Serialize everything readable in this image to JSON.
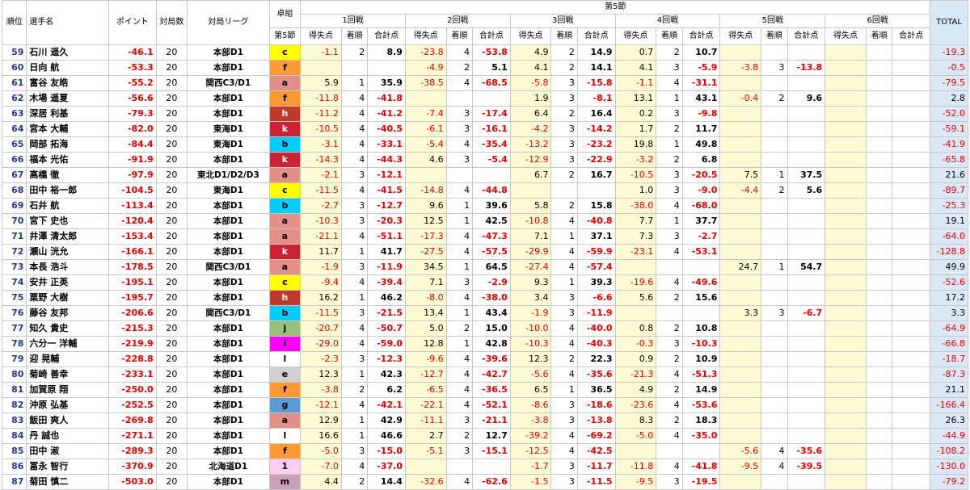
{
  "header": {
    "rank": "順位",
    "player": "選手名",
    "points": "ポイント",
    "games": "対局数",
    "league": "対局リーグ",
    "table_group": "卓組",
    "section": "第5節",
    "section_sub": "第5節",
    "rounds": [
      "1回戦",
      "2回戦",
      "3回戦",
      "4回戦",
      "5回戦",
      "6回戦"
    ],
    "score": "得失点",
    "place": "着順",
    "cumulative": "合計点",
    "total": "TOTAL"
  },
  "colors": {
    "c": "#ffff00",
    "f": "#ff9933",
    "a": "#e39089",
    "h": "#c0392b",
    "b": "#00ccff",
    "k": "#cc2233",
    "j": "#99c07a",
    "i": "#ff00ff",
    "l": "#ffffff",
    "e": "#d0d0d0",
    "g": "#5b9bd5",
    "1": "#ffccf2",
    "m": "#c8a0b8"
  },
  "rows": [
    {
      "rank": "59",
      "name": "石川 遥久",
      "points": "-46.1",
      "games": "20",
      "league": "本部D1",
      "table": "c",
      "r": [
        [
          "-1.1",
          "2",
          "8.9"
        ],
        [
          "-23.8",
          "4",
          "-53.8"
        ],
        [
          "4.9",
          "2",
          "14.9"
        ],
        [
          "0.7",
          "2",
          "10.7"
        ],
        [
          "",
          "",
          ""
        ],
        [
          "",
          "",
          ""
        ]
      ],
      "total": "-19.3"
    },
    {
      "rank": "60",
      "name": "日向 航",
      "points": "-53.3",
      "games": "20",
      "league": "本部D1",
      "table": "f",
      "r": [
        [
          "",
          "",
          ""
        ],
        [
          "-4.9",
          "2",
          "5.1"
        ],
        [
          "4.1",
          "2",
          "14.1"
        ],
        [
          "4.1",
          "3",
          "-5.9"
        ],
        [
          "-3.8",
          "3",
          "-13.8"
        ],
        [
          "",
          "",
          ""
        ]
      ],
      "total": "-0.5"
    },
    {
      "rank": "61",
      "name": "富谷 友皓",
      "points": "-55.2",
      "games": "20",
      "league": "関西C3/D1",
      "table": "a",
      "r": [
        [
          "5.9",
          "1",
          "35.9"
        ],
        [
          "-38.5",
          "4",
          "-68.5"
        ],
        [
          "-5.8",
          "3",
          "-15.8"
        ],
        [
          "-1.1",
          "4",
          "-31.1"
        ],
        [
          "",
          "",
          ""
        ],
        [
          "",
          "",
          ""
        ]
      ],
      "total": "-79.5"
    },
    {
      "rank": "62",
      "name": "木場 遥夏",
      "points": "-56.6",
      "games": "20",
      "league": "本部D1",
      "table": "f",
      "r": [
        [
          "-11.8",
          "4",
          "-41.8"
        ],
        [
          "",
          "",
          ""
        ],
        [
          "1.9",
          "3",
          "-8.1"
        ],
        [
          "13.1",
          "1",
          "43.1"
        ],
        [
          "-0.4",
          "2",
          "9.6"
        ],
        [
          "",
          "",
          ""
        ]
      ],
      "total": "2.8"
    },
    {
      "rank": "63",
      "name": "深居 利基",
      "points": "-79.3",
      "games": "20",
      "league": "本部D1",
      "table": "h",
      "r": [
        [
          "-11.2",
          "4",
          "-41.2"
        ],
        [
          "-7.4",
          "3",
          "-17.4"
        ],
        [
          "6.4",
          "2",
          "16.4"
        ],
        [
          "0.2",
          "3",
          "-9.8"
        ],
        [
          "",
          "",
          ""
        ],
        [
          "",
          "",
          ""
        ]
      ],
      "total": "-52.0"
    },
    {
      "rank": "64",
      "name": "宮本 大輔",
      "points": "-82.0",
      "games": "20",
      "league": "東海D1",
      "table": "k",
      "r": [
        [
          "-10.5",
          "4",
          "-40.5"
        ],
        [
          "-6.1",
          "3",
          "-16.1"
        ],
        [
          "-4.2",
          "3",
          "-14.2"
        ],
        [
          "1.7",
          "2",
          "11.7"
        ],
        [
          "",
          "",
          ""
        ],
        [
          "",
          "",
          ""
        ]
      ],
      "total": "-59.1"
    },
    {
      "rank": "65",
      "name": "岡部 拓海",
      "points": "-84.4",
      "games": "20",
      "league": "東海D1",
      "table": "b",
      "r": [
        [
          "-3.1",
          "4",
          "-33.1"
        ],
        [
          "-5.4",
          "4",
          "-35.4"
        ],
        [
          "-13.2",
          "3",
          "-23.2"
        ],
        [
          "19.8",
          "1",
          "49.8"
        ],
        [
          "",
          "",
          ""
        ],
        [
          "",
          "",
          ""
        ]
      ],
      "total": "-41.9"
    },
    {
      "rank": "66",
      "name": "福本 光佑",
      "points": "-91.9",
      "games": "20",
      "league": "本部D1",
      "table": "k",
      "r": [
        [
          "-14.3",
          "4",
          "-44.3"
        ],
        [
          "4.6",
          "3",
          "-5.4"
        ],
        [
          "-12.9",
          "3",
          "-22.9"
        ],
        [
          "-3.2",
          "2",
          "6.8"
        ],
        [
          "",
          "",
          ""
        ],
        [
          "",
          "",
          ""
        ]
      ],
      "total": "-65.8"
    },
    {
      "rank": "67",
      "name": "高橋 徹",
      "points": "-97.9",
      "games": "20",
      "league": "東北D1/D2/D3",
      "table": "a",
      "r": [
        [
          "-2.1",
          "3",
          "-12.1"
        ],
        [
          "",
          "",
          ""
        ],
        [
          "6.7",
          "2",
          "16.7"
        ],
        [
          "-10.5",
          "3",
          "-20.5"
        ],
        [
          "7.5",
          "1",
          "37.5"
        ],
        [
          "",
          "",
          ""
        ]
      ],
      "total": "21.6"
    },
    {
      "rank": "68",
      "name": "田中 裕一郎",
      "points": "-104.5",
      "games": "20",
      "league": "東海D1",
      "table": "c",
      "r": [
        [
          "-11.5",
          "4",
          "-41.5"
        ],
        [
          "-14.8",
          "4",
          "-44.8"
        ],
        [
          "",
          "",
          ""
        ],
        [
          "1.0",
          "3",
          "-9.0"
        ],
        [
          "-4.4",
          "2",
          "5.6"
        ],
        [
          "",
          "",
          ""
        ]
      ],
      "total": "-89.7"
    },
    {
      "rank": "69",
      "name": "石井 航",
      "points": "-113.4",
      "games": "20",
      "league": "本部D1",
      "table": "b",
      "r": [
        [
          "-2.7",
          "3",
          "-12.7"
        ],
        [
          "9.6",
          "1",
          "39.6"
        ],
        [
          "5.8",
          "2",
          "15.8"
        ],
        [
          "-38.0",
          "4",
          "-68.0"
        ],
        [
          "",
          "",
          ""
        ],
        [
          "",
          "",
          ""
        ]
      ],
      "total": "-25.3"
    },
    {
      "rank": "70",
      "name": "宮下 史也",
      "points": "-120.4",
      "games": "20",
      "league": "本部D1",
      "table": "a",
      "r": [
        [
          "-10.3",
          "3",
          "-20.3"
        ],
        [
          "12.5",
          "1",
          "42.5"
        ],
        [
          "-10.8",
          "4",
          "-40.8"
        ],
        [
          "7.7",
          "1",
          "37.7"
        ],
        [
          "",
          "",
          ""
        ],
        [
          "",
          "",
          ""
        ]
      ],
      "total": "19.1"
    },
    {
      "rank": "71",
      "name": "井澤 清太郎",
      "points": "-153.4",
      "games": "20",
      "league": "本部D1",
      "table": "a",
      "r": [
        [
          "-21.1",
          "4",
          "-51.1"
        ],
        [
          "-17.3",
          "4",
          "-47.3"
        ],
        [
          "7.1",
          "1",
          "37.1"
        ],
        [
          "7.3",
          "3",
          "-2.7"
        ],
        [
          "",
          "",
          ""
        ],
        [
          "",
          "",
          ""
        ]
      ],
      "total": "-64.0"
    },
    {
      "rank": "72",
      "name": "瀬山 洸允",
      "points": "-166.1",
      "games": "20",
      "league": "本部D1",
      "table": "k",
      "r": [
        [
          "11.7",
          "1",
          "41.7"
        ],
        [
          "-27.5",
          "4",
          "-57.5"
        ],
        [
          "-29.9",
          "4",
          "-59.9"
        ],
        [
          "-23.1",
          "4",
          "-53.1"
        ],
        [
          "",
          "",
          ""
        ],
        [
          "",
          "",
          ""
        ]
      ],
      "total": "-128.8"
    },
    {
      "rank": "73",
      "name": "本長 浩斗",
      "points": "-178.5",
      "games": "20",
      "league": "関西C3/D1",
      "table": "a",
      "r": [
        [
          "-1.9",
          "3",
          "-11.9"
        ],
        [
          "34.5",
          "1",
          "64.5"
        ],
        [
          "-27.4",
          "4",
          "-57.4"
        ],
        [
          "",
          "",
          ""
        ],
        [
          "24.7",
          "1",
          "54.7"
        ],
        [
          "",
          "",
          ""
        ]
      ],
      "total": "49.9"
    },
    {
      "rank": "74",
      "name": "安井 正英",
      "points": "-195.1",
      "games": "20",
      "league": "本部D1",
      "table": "c",
      "r": [
        [
          "-9.4",
          "4",
          "-39.4"
        ],
        [
          "7.1",
          "3",
          "-2.9"
        ],
        [
          "9.3",
          "1",
          "39.3"
        ],
        [
          "-19.6",
          "4",
          "-49.6"
        ],
        [
          "",
          "",
          ""
        ],
        [
          "",
          "",
          ""
        ]
      ],
      "total": "-52.6"
    },
    {
      "rank": "75",
      "name": "粟野 大樹",
      "points": "-195.7",
      "games": "20",
      "league": "本部D1",
      "table": "h",
      "r": [
        [
          "16.2",
          "1",
          "46.2"
        ],
        [
          "-8.0",
          "4",
          "-38.0"
        ],
        [
          "3.4",
          "3",
          "-6.6"
        ],
        [
          "5.6",
          "2",
          "15.6"
        ],
        [
          "",
          "",
          ""
        ],
        [
          "",
          "",
          ""
        ]
      ],
      "total": "17.2"
    },
    {
      "rank": "76",
      "name": "藤谷 友邦",
      "points": "-206.6",
      "games": "20",
      "league": "関西C3/D1",
      "table": "b",
      "r": [
        [
          "-11.5",
          "3",
          "-21.5"
        ],
        [
          "13.4",
          "1",
          "43.4"
        ],
        [
          "-1.9",
          "3",
          "-11.9"
        ],
        [
          "",
          "",
          ""
        ],
        [
          "3.3",
          "3",
          "-6.7"
        ],
        [
          "",
          "",
          ""
        ]
      ],
      "total": "3.3"
    },
    {
      "rank": "77",
      "name": "知久 貴史",
      "points": "-215.3",
      "games": "20",
      "league": "本部D1",
      "table": "j",
      "r": [
        [
          "-20.7",
          "4",
          "-50.7"
        ],
        [
          "5.0",
          "2",
          "15.0"
        ],
        [
          "-10.0",
          "4",
          "-40.0"
        ],
        [
          "0.8",
          "2",
          "10.8"
        ],
        [
          "",
          "",
          ""
        ],
        [
          "",
          "",
          ""
        ]
      ],
      "total": "-64.9"
    },
    {
      "rank": "78",
      "name": "六分一 洋輔",
      "points": "-219.9",
      "games": "20",
      "league": "本部D1",
      "table": "i",
      "r": [
        [
          "-29.0",
          "4",
          "-59.0"
        ],
        [
          "12.8",
          "1",
          "42.8"
        ],
        [
          "-10.3",
          "4",
          "-40.3"
        ],
        [
          "-0.3",
          "3",
          "-10.3"
        ],
        [
          "",
          "",
          ""
        ],
        [
          "",
          "",
          ""
        ]
      ],
      "total": "-66.8"
    },
    {
      "rank": "79",
      "name": "迎 晃輔",
      "points": "-228.8",
      "games": "20",
      "league": "本部D1",
      "table": "l",
      "r": [
        [
          "-2.3",
          "3",
          "-12.3"
        ],
        [
          "-9.6",
          "4",
          "-39.6"
        ],
        [
          "12.3",
          "2",
          "22.3"
        ],
        [
          "0.9",
          "2",
          "10.9"
        ],
        [
          "",
          "",
          ""
        ],
        [
          "",
          "",
          ""
        ]
      ],
      "total": "-18.7"
    },
    {
      "rank": "80",
      "name": "菊崎 善幸",
      "points": "-233.1",
      "games": "20",
      "league": "本部D1",
      "table": "e",
      "r": [
        [
          "12.3",
          "1",
          "42.3"
        ],
        [
          "-12.7",
          "4",
          "-42.7"
        ],
        [
          "-5.6",
          "4",
          "-35.6"
        ],
        [
          "-21.3",
          "4",
          "-51.3"
        ],
        [
          "",
          "",
          ""
        ],
        [
          "",
          "",
          ""
        ]
      ],
      "total": "-87.3"
    },
    {
      "rank": "81",
      "name": "加賀原 翔",
      "points": "-250.0",
      "games": "20",
      "league": "本部D1",
      "table": "f",
      "r": [
        [
          "-3.8",
          "2",
          "6.2"
        ],
        [
          "-6.5",
          "4",
          "-36.5"
        ],
        [
          "6.5",
          "1",
          "36.5"
        ],
        [
          "4.9",
          "2",
          "14.9"
        ],
        [
          "",
          "",
          ""
        ],
        [
          "",
          "",
          ""
        ]
      ],
      "total": "21.1"
    },
    {
      "rank": "82",
      "name": "沖原 弘基",
      "points": "-252.5",
      "games": "20",
      "league": "本部D1",
      "table": "g",
      "r": [
        [
          "-12.1",
          "4",
          "-42.1"
        ],
        [
          "-22.1",
          "4",
          "-52.1"
        ],
        [
          "-8.6",
          "3",
          "-18.6"
        ],
        [
          "-23.6",
          "4",
          "-53.6"
        ],
        [
          "",
          "",
          ""
        ],
        [
          "",
          "",
          ""
        ]
      ],
      "total": "-166.4"
    },
    {
      "rank": "83",
      "name": "飯田 爽人",
      "points": "-269.8",
      "games": "20",
      "league": "本部D1",
      "table": "a",
      "r": [
        [
          "12.9",
          "1",
          "42.9"
        ],
        [
          "-11.1",
          "3",
          "-21.1"
        ],
        [
          "-3.8",
          "3",
          "-13.8"
        ],
        [
          "8.3",
          "2",
          "18.3"
        ],
        [
          "",
          "",
          ""
        ],
        [
          "",
          "",
          ""
        ]
      ],
      "total": "26.3"
    },
    {
      "rank": "84",
      "name": "丹 誠也",
      "points": "-271.1",
      "games": "20",
      "league": "本部D1",
      "table": "l",
      "r": [
        [
          "16.6",
          "1",
          "46.6"
        ],
        [
          "2.7",
          "2",
          "12.7"
        ],
        [
          "-39.2",
          "4",
          "-69.2"
        ],
        [
          "-5.0",
          "4",
          "-35.0"
        ],
        [
          "",
          "",
          ""
        ],
        [
          "",
          "",
          ""
        ]
      ],
      "total": "-44.9"
    },
    {
      "rank": "85",
      "name": "田中 淑",
      "points": "-289.3",
      "games": "20",
      "league": "本部D1",
      "table": "f",
      "r": [
        [
          "-5.0",
          "3",
          "-15.0"
        ],
        [
          "-5.1",
          "3",
          "-15.1"
        ],
        [
          "-12.5",
          "4",
          "-42.5"
        ],
        [
          "",
          "",
          ""
        ],
        [
          "-5.6",
          "4",
          "-35.6"
        ],
        [
          "",
          "",
          ""
        ]
      ],
      "total": "-108.2"
    },
    {
      "rank": "86",
      "name": "冨永 智行",
      "points": "-370.9",
      "games": "20",
      "league": "北海道D1",
      "table": "1",
      "r": [
        [
          "-7.0",
          "4",
          "-37.0"
        ],
        [
          "",
          "",
          ""
        ],
        [
          "-1.7",
          "3",
          "-11.7"
        ],
        [
          "-11.8",
          "4",
          "-41.8"
        ],
        [
          "-9.5",
          "4",
          "-39.5"
        ],
        [
          "",
          "",
          ""
        ]
      ],
      "total": "-130.0"
    },
    {
      "rank": "87",
      "name": "菊田 慎二",
      "points": "-503.0",
      "games": "20",
      "league": "本部D1",
      "table": "m",
      "r": [
        [
          "4.4",
          "2",
          "14.4"
        ],
        [
          "-32.6",
          "4",
          "-62.6"
        ],
        [
          "-1.5",
          "3",
          "-11.5"
        ],
        [
          "-9.5",
          "3",
          "-19.5"
        ],
        [
          "",
          "",
          ""
        ],
        [
          "",
          "",
          ""
        ]
      ],
      "total": "-79.2"
    }
  ]
}
